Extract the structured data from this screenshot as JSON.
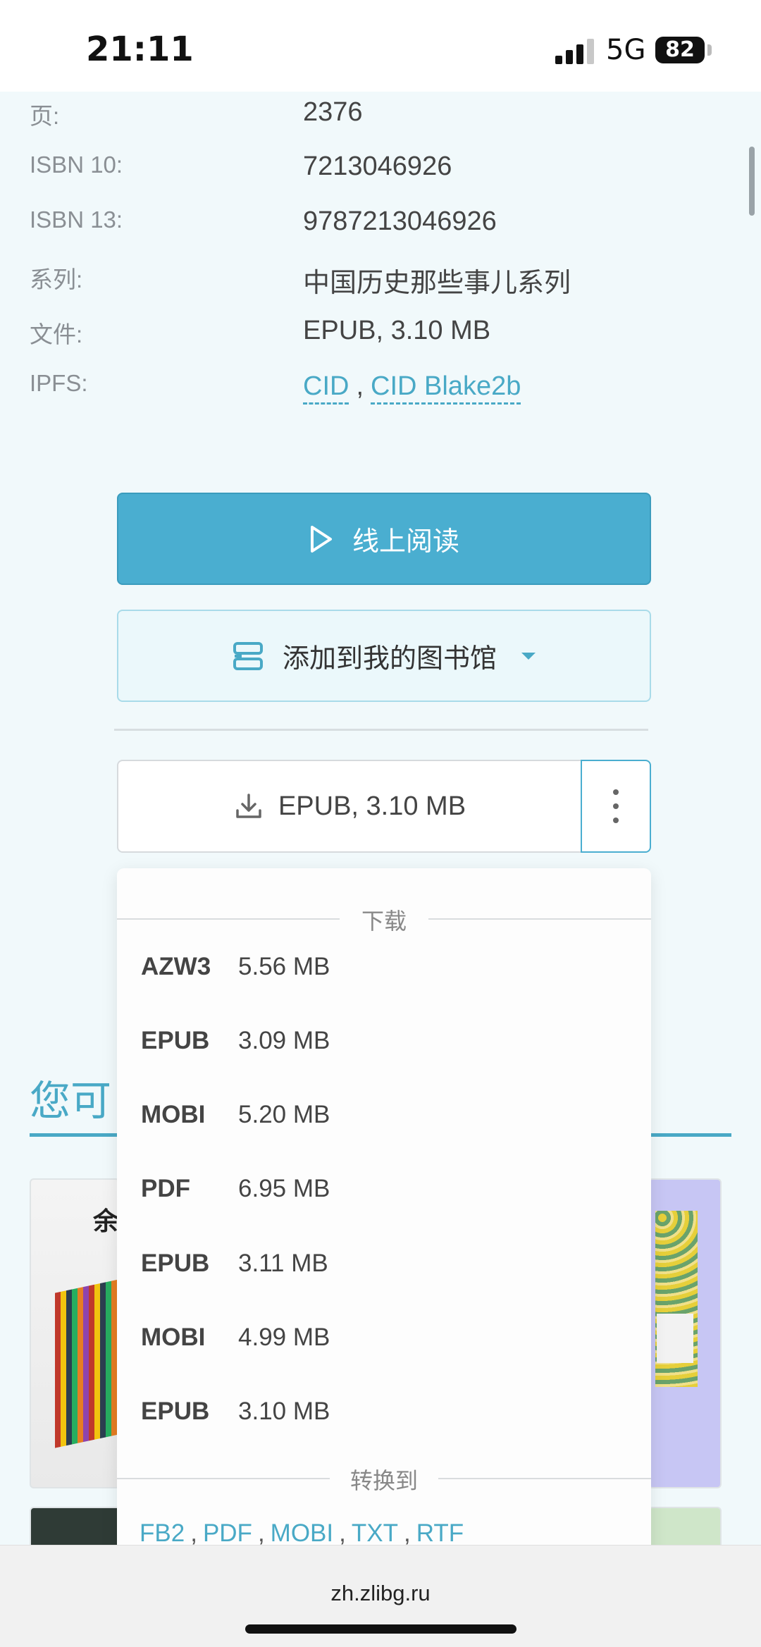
{
  "status_bar": {
    "time": "21:11",
    "network": "5G",
    "battery": "82"
  },
  "details": [
    {
      "label": "页:",
      "value": "2376"
    },
    {
      "label": "ISBN 10:",
      "value": "7213046926"
    },
    {
      "label": "ISBN 13:",
      "value": "9787213046926"
    },
    {
      "label": "系列:",
      "value": "中国历史那些事儿系列"
    },
    {
      "label": "文件:",
      "value": "EPUB, 3.10 MB"
    }
  ],
  "ipfs": {
    "label": "IPFS:",
    "links": [
      "CID",
      "CID Blake2b"
    ],
    "separator": ","
  },
  "actions": {
    "read_online": "线上阅读",
    "add_to_library": "添加到我的图书馆",
    "download_main": "EPUB, 3.10 MB"
  },
  "download_menu": {
    "download_header": "下载",
    "items": [
      {
        "format": "AZW3",
        "size": "5.56 MB"
      },
      {
        "format": "EPUB",
        "size": "3.09 MB"
      },
      {
        "format": "MOBI",
        "size": "5.20 MB"
      },
      {
        "format": "PDF",
        "size": "6.95 MB"
      },
      {
        "format": "EPUB",
        "size": "3.11 MB"
      },
      {
        "format": "MOBI",
        "size": "4.99 MB"
      },
      {
        "format": "EPUB",
        "size": "3.10 MB"
      }
    ],
    "convert_header": "转换到",
    "convert_formats": [
      "FB2",
      "PDF",
      "MOBI",
      "TXT",
      "RTF"
    ]
  },
  "section": {
    "title": "您可"
  },
  "book_glyph": "余",
  "browser": {
    "url": "zh.zlibg.ru"
  },
  "colors": {
    "accent": "#4aaed0",
    "link": "#49a9c6",
    "background": "#f1f9fb"
  }
}
